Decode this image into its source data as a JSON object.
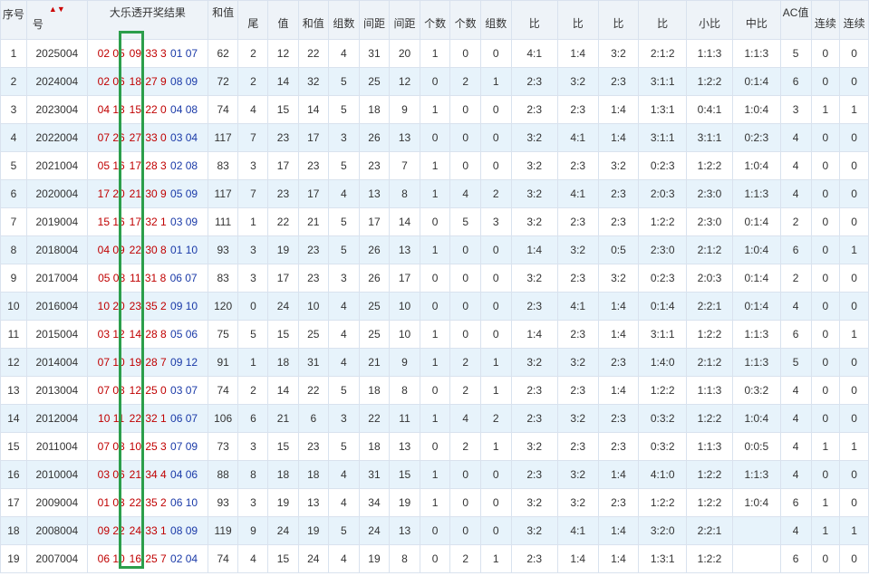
{
  "headers": {
    "seq": "序号",
    "period_line1": "",
    "period_line2": "号",
    "result": "大乐透开奖结果",
    "sum": "和值",
    "tail": "尾",
    "col_value": "值",
    "col_sum_value": "和值",
    "col_groups": "组数",
    "col_gap1": "间距",
    "col_gap2": "间距",
    "col_count1": "个数",
    "col_count2": "个数",
    "col_groups2": "组数",
    "ratio1": "比",
    "ratio2": "比",
    "ratio3": "比",
    "ratio4": "比",
    "ratio5": "小比",
    "ratio6": "中比",
    "ac": "AC值",
    "consec1": "连续",
    "consec2": "连续"
  },
  "rows": [
    {
      "n": "1",
      "period": "2025004",
      "r1": "02 05",
      "r2": "09",
      "r3": "3 33",
      "b": "01 07",
      "sum": "62",
      "c1": "2",
      "c2": "12",
      "c3": "22",
      "c4": "4",
      "c5": "31",
      "c6": "20",
      "c7": "1",
      "c8": "0",
      "c9": "0",
      "q1": "4:1",
      "q2": "1:4",
      "q3": "3:2",
      "q4": "2:1:2",
      "q5": "1:1:3",
      "q6": "1:1:3",
      "ac": "5",
      "k1": "0",
      "k2": "0"
    },
    {
      "n": "2",
      "period": "2024004",
      "r1": "02 06",
      "r2": "18",
      "r3": "9 27",
      "b": "08 09",
      "sum": "72",
      "c1": "2",
      "c2": "14",
      "c3": "32",
      "c4": "5",
      "c5": "25",
      "c6": "12",
      "c7": "0",
      "c8": "2",
      "c9": "1",
      "q1": "2:3",
      "q2": "3:2",
      "q3": "2:3",
      "q4": "3:1:1",
      "q5": "1:2:2",
      "q6": "0:1:4",
      "ac": "6",
      "k1": "0",
      "k2": "0"
    },
    {
      "n": "3",
      "period": "2023004",
      "r1": "04 13",
      "r2": "15",
      "r3": "0 22",
      "b": "04 08",
      "sum": "74",
      "c1": "4",
      "c2": "15",
      "c3": "14",
      "c4": "5",
      "c5": "18",
      "c6": "9",
      "c7": "1",
      "c8": "0",
      "c9": "0",
      "q1": "2:3",
      "q2": "2:3",
      "q3": "1:4",
      "q4": "1:3:1",
      "q5": "0:4:1",
      "q6": "1:0:4",
      "ac": "3",
      "k1": "1",
      "k2": "1"
    },
    {
      "n": "4",
      "period": "2022004",
      "r1": "07 26",
      "r2": "27",
      "r3": "0 33",
      "b": "03 04",
      "sum": "117",
      "c1": "7",
      "c2": "23",
      "c3": "17",
      "c4": "3",
      "c5": "26",
      "c6": "13",
      "c7": "0",
      "c8": "0",
      "c9": "0",
      "q1": "3:2",
      "q2": "4:1",
      "q3": "1:4",
      "q4": "3:1:1",
      "q5": "3:1:1",
      "q6": "0:2:3",
      "ac": "4",
      "k1": "0",
      "k2": "0"
    },
    {
      "n": "5",
      "period": "2021004",
      "r1": "05 16",
      "r2": "17",
      "r3": "3 28",
      "b": "02 08",
      "sum": "83",
      "c1": "3",
      "c2": "17",
      "c3": "23",
      "c4": "5",
      "c5": "23",
      "c6": "7",
      "c7": "1",
      "c8": "0",
      "c9": "0",
      "q1": "3:2",
      "q2": "2:3",
      "q3": "3:2",
      "q4": "0:2:3",
      "q5": "1:2:2",
      "q6": "1:0:4",
      "ac": "4",
      "k1": "0",
      "k2": "0"
    },
    {
      "n": "6",
      "period": "2020004",
      "r1": "17 20",
      "r2": "21",
      "r3": "9 30",
      "b": "05 09",
      "sum": "117",
      "c1": "7",
      "c2": "23",
      "c3": "17",
      "c4": "4",
      "c5": "13",
      "c6": "8",
      "c7": "1",
      "c8": "4",
      "c9": "2",
      "q1": "3:2",
      "q2": "4:1",
      "q3": "2:3",
      "q4": "2:0:3",
      "q5": "2:3:0",
      "q6": "1:1:3",
      "ac": "4",
      "k1": "0",
      "k2": "0"
    },
    {
      "n": "7",
      "period": "2019004",
      "r1": "15 16",
      "r2": "17",
      "r3": "1 32",
      "b": "03 09",
      "sum": "111",
      "c1": "1",
      "c2": "22",
      "c3": "21",
      "c4": "5",
      "c5": "17",
      "c6": "14",
      "c7": "0",
      "c8": "5",
      "c9": "3",
      "q1": "3:2",
      "q2": "2:3",
      "q3": "2:3",
      "q4": "1:2:2",
      "q5": "2:3:0",
      "q6": "0:1:4",
      "ac": "2",
      "k1": "0",
      "k2": "0"
    },
    {
      "n": "8",
      "period": "2018004",
      "r1": "04 09",
      "r2": "22",
      "r3": "8 30",
      "b": "01 10",
      "sum": "93",
      "c1": "3",
      "c2": "19",
      "c3": "23",
      "c4": "5",
      "c5": "26",
      "c6": "13",
      "c7": "1",
      "c8": "0",
      "c9": "0",
      "q1": "1:4",
      "q2": "3:2",
      "q3": "0:5",
      "q4": "2:3:0",
      "q5": "2:1:2",
      "q6": "1:0:4",
      "ac": "6",
      "k1": "0",
      "k2": "1"
    },
    {
      "n": "9",
      "period": "2017004",
      "r1": "05 08",
      "r2": "11",
      "r3": "8 31",
      "b": "06 07",
      "sum": "83",
      "c1": "3",
      "c2": "17",
      "c3": "23",
      "c4": "3",
      "c5": "26",
      "c6": "17",
      "c7": "0",
      "c8": "0",
      "c9": "0",
      "q1": "3:2",
      "q2": "2:3",
      "q3": "3:2",
      "q4": "0:2:3",
      "q5": "2:0:3",
      "q6": "0:1:4",
      "ac": "2",
      "k1": "0",
      "k2": "0"
    },
    {
      "n": "10",
      "period": "2016004",
      "r1": "10 20",
      "r2": "23",
      "r3": "2 35",
      "b": "09 10",
      "sum": "120",
      "c1": "0",
      "c2": "24",
      "c3": "10",
      "c4": "4",
      "c5": "25",
      "c6": "10",
      "c7": "0",
      "c8": "0",
      "c9": "0",
      "q1": "2:3",
      "q2": "4:1",
      "q3": "1:4",
      "q4": "0:1:4",
      "q5": "2:2:1",
      "q6": "0:1:4",
      "ac": "4",
      "k1": "0",
      "k2": "0"
    },
    {
      "n": "11",
      "period": "2015004",
      "r1": "03 12",
      "r2": "14",
      "r3": "8 28",
      "b": "05 06",
      "sum": "75",
      "c1": "5",
      "c2": "15",
      "c3": "25",
      "c4": "4",
      "c5": "25",
      "c6": "10",
      "c7": "1",
      "c8": "0",
      "c9": "0",
      "q1": "1:4",
      "q2": "2:3",
      "q3": "1:4",
      "q4": "3:1:1",
      "q5": "1:2:2",
      "q6": "1:1:3",
      "ac": "6",
      "k1": "0",
      "k2": "1"
    },
    {
      "n": "12",
      "period": "2014004",
      "r1": "07 10",
      "r2": "19",
      "r3": "7 28",
      "b": "09 12",
      "sum": "91",
      "c1": "1",
      "c2": "18",
      "c3": "31",
      "c4": "4",
      "c5": "21",
      "c6": "9",
      "c7": "1",
      "c8": "2",
      "c9": "1",
      "q1": "3:2",
      "q2": "3:2",
      "q3": "2:3",
      "q4": "1:4:0",
      "q5": "2:1:2",
      "q6": "1:1:3",
      "ac": "5",
      "k1": "0",
      "k2": "0"
    },
    {
      "n": "13",
      "period": "2013004",
      "r1": "07 08",
      "r2": "12",
      "r3": "0 25",
      "b": "03 07",
      "sum": "74",
      "c1": "2",
      "c2": "14",
      "c3": "22",
      "c4": "5",
      "c5": "18",
      "c6": "8",
      "c7": "0",
      "c8": "2",
      "c9": "1",
      "q1": "2:3",
      "q2": "2:3",
      "q3": "1:4",
      "q4": "1:2:2",
      "q5": "1:1:3",
      "q6": "0:3:2",
      "ac": "4",
      "k1": "0",
      "k2": "0"
    },
    {
      "n": "14",
      "period": "2012004",
      "r1": "10 11",
      "r2": "22",
      "r3": "1 32",
      "b": "06 07",
      "sum": "106",
      "c1": "6",
      "c2": "21",
      "c3": "6",
      "c4": "3",
      "c5": "22",
      "c6": "11",
      "c7": "1",
      "c8": "4",
      "c9": "2",
      "q1": "2:3",
      "q2": "3:2",
      "q3": "2:3",
      "q4": "0:3:2",
      "q5": "1:2:2",
      "q6": "1:0:4",
      "ac": "4",
      "k1": "0",
      "k2": "0"
    },
    {
      "n": "15",
      "period": "2011004",
      "r1": "07 08",
      "r2": "10",
      "r3": "3 25",
      "b": "07 09",
      "sum": "73",
      "c1": "3",
      "c2": "15",
      "c3": "23",
      "c4": "5",
      "c5": "18",
      "c6": "13",
      "c7": "0",
      "c8": "2",
      "c9": "1",
      "q1": "3:2",
      "q2": "2:3",
      "q3": "2:3",
      "q4": "0:3:2",
      "q5": "1:1:3",
      "q6": "0:0:5",
      "ac": "4",
      "k1": "1",
      "k2": "1"
    },
    {
      "n": "16",
      "period": "2010004",
      "r1": "03 06",
      "r2": "21",
      "r3": "4 34",
      "b": "04 06",
      "sum": "88",
      "c1": "8",
      "c2": "18",
      "c3": "18",
      "c4": "4",
      "c5": "31",
      "c6": "15",
      "c7": "1",
      "c8": "0",
      "c9": "0",
      "q1": "2:3",
      "q2": "3:2",
      "q3": "1:4",
      "q4": "4:1:0",
      "q5": "1:2:2",
      "q6": "1:1:3",
      "ac": "4",
      "k1": "0",
      "k2": "0"
    },
    {
      "n": "17",
      "period": "2009004",
      "r1": "01 03",
      "r2": "22",
      "r3": "2 35",
      "b": "06 10",
      "sum": "93",
      "c1": "3",
      "c2": "19",
      "c3": "13",
      "c4": "4",
      "c5": "34",
      "c6": "19",
      "c7": "1",
      "c8": "0",
      "c9": "0",
      "q1": "3:2",
      "q2": "3:2",
      "q3": "2:3",
      "q4": "1:2:2",
      "q5": "1:2:2",
      "q6": "1:0:4",
      "ac": "6",
      "k1": "1",
      "k2": "0"
    },
    {
      "n": "18",
      "period": "2008004",
      "r1": "09 22",
      "r2": "24",
      "r3": "1 33",
      "b": "08 09",
      "sum": "119",
      "c1": "9",
      "c2": "24",
      "c3": "19",
      "c4": "5",
      "c5": "24",
      "c6": "13",
      "c7": "0",
      "c8": "0",
      "c9": "0",
      "q1": "3:2",
      "q2": "4:1",
      "q3": "1:4",
      "q4": "3:2:0",
      "q5": "2:2:1",
      "q6": "",
      "ac": "4",
      "k1": "1",
      "k2": "1"
    },
    {
      "n": "19",
      "period": "2007004",
      "r1": "06 10",
      "r2": "16",
      "r3": "7 25",
      "b": "02 04",
      "sum": "74",
      "c1": "4",
      "c2": "15",
      "c3": "24",
      "c4": "4",
      "c5": "19",
      "c6": "8",
      "c7": "0",
      "c8": "2",
      "c9": "1",
      "q1": "2:3",
      "q2": "1:4",
      "q3": "1:4",
      "q4": "1:3:1",
      "q5": "1:2:2",
      "q6": "",
      "ac": "6",
      "k1": "0",
      "k2": "0"
    }
  ]
}
